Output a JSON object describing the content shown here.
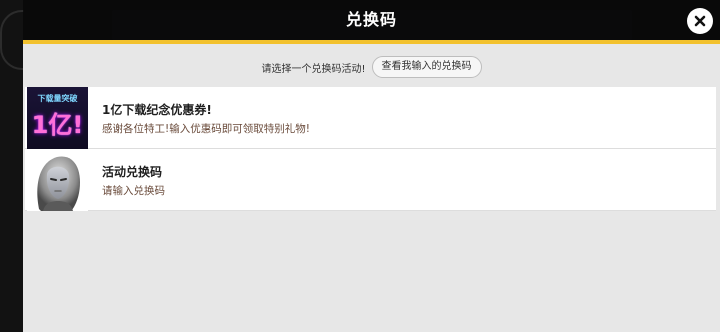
{
  "modal": {
    "title": "兑换码",
    "close_icon": "close-icon",
    "accent_color": "#f2c12e"
  },
  "prompt": {
    "text": "请选择一个兑换码活动!",
    "view_button": "查看我输入的兑换码"
  },
  "items": [
    {
      "title": "1亿下载纪念优惠券!",
      "description": "感谢各位特工!输入优惠码即可领取特别礼物!",
      "thumbnail": {
        "top_text": "下载量突破",
        "big_text": "1亿!"
      }
    },
    {
      "title": "活动兑换码",
      "description": "请输入兑换码",
      "thumbnail": {
        "icon": "character-portrait-icon"
      }
    }
  ]
}
